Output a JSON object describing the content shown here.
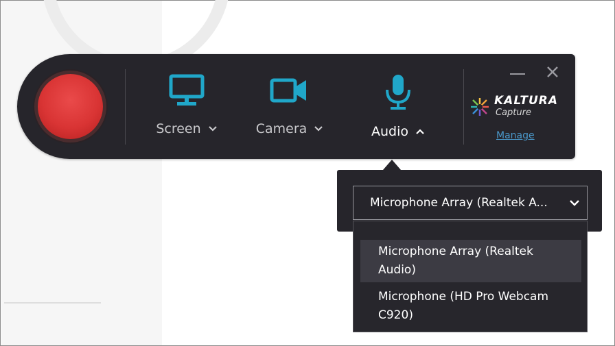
{
  "toolbar": {
    "tools": [
      {
        "label": "Screen",
        "icon": "monitor-icon",
        "expanded": false
      },
      {
        "label": "Camera",
        "icon": "video-camera-icon",
        "expanded": false
      },
      {
        "label": "Audio",
        "icon": "microphone-icon",
        "expanded": true
      }
    ],
    "brand_name": "KALTURA",
    "brand_sub": "Capture",
    "manage_label": "Manage"
  },
  "audio_popup": {
    "selected_value": "Microphone Array (Realtek A...",
    "options": [
      {
        "line1": "Microphone Array (Realtek",
        "line2": "Audio)"
      },
      {
        "line1": "Microphone (HD Pro Webcam",
        "line2": "C920)"
      }
    ]
  },
  "colors": {
    "toolbar_bg": "#26252b",
    "accent_teal": "#20a7c9",
    "record_red": "#d93434",
    "link_blue": "#4a97c9"
  }
}
